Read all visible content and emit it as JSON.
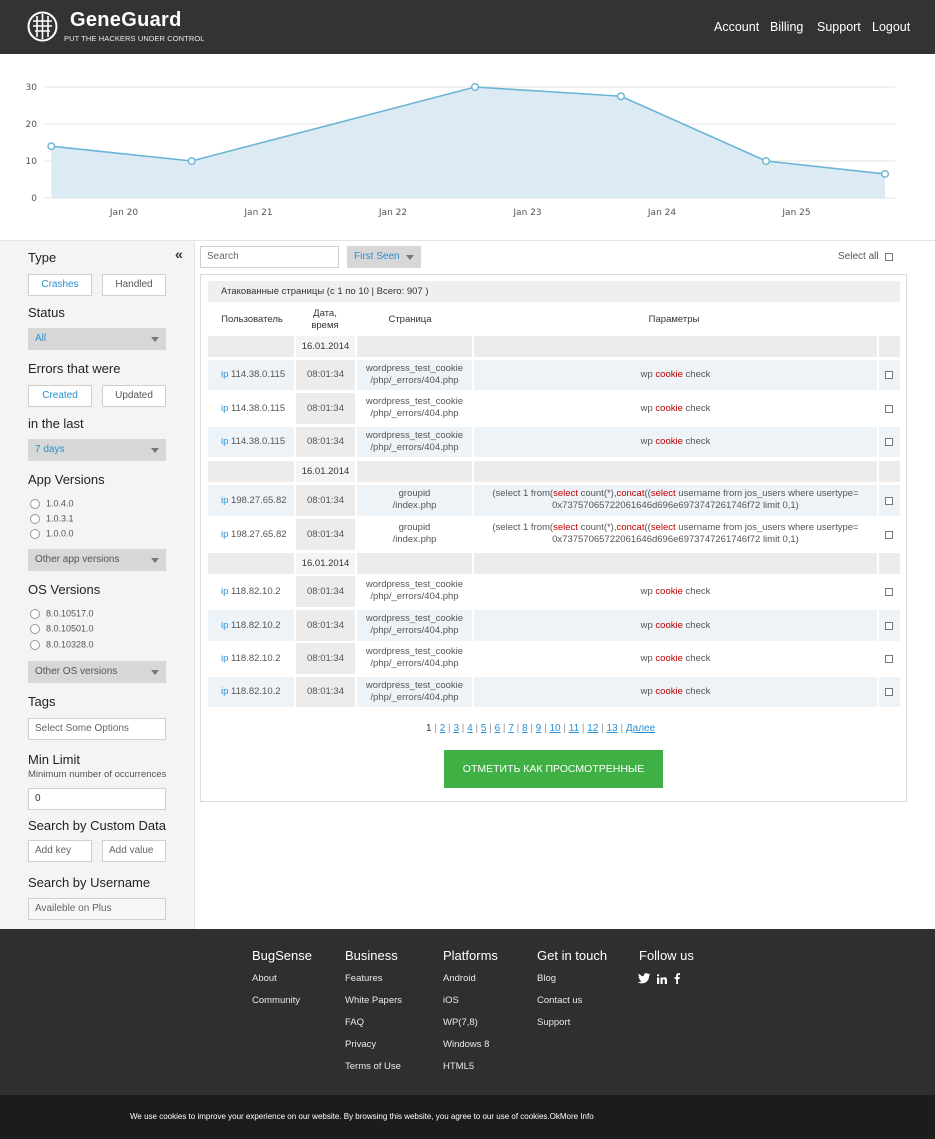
{
  "header": {
    "brand": "GeneGuard",
    "tagline": "PUT THE HACKERS UNDER CONTROL",
    "nav": [
      "Account",
      "Billing",
      "Support",
      "Logout"
    ]
  },
  "chart_data": {
    "type": "area",
    "x": [
      "Jan 19.8",
      "Jan 20.8",
      "Jan 21.8",
      "Jan 22.8",
      "Jan 23.8",
      "Jan 24.8",
      "Jan 25.7"
    ],
    "categories": [
      "Jan 20",
      "Jan 21",
      "Jan 22",
      "Jan 23",
      "Jan 24",
      "Jan 25"
    ],
    "values": [
      14,
      10,
      30,
      27.5,
      10,
      6.5
    ],
    "y_ticks": [
      "0",
      "10",
      "20",
      "30"
    ],
    "ylim": [
      0,
      32
    ],
    "grid": true,
    "colors": {
      "line": "#6bb4d6",
      "fill": "#dceaf3"
    }
  },
  "sidebar": {
    "type_label": "Type",
    "type_options": [
      "Crashes",
      "Handled"
    ],
    "status_label": "Status",
    "status_value": "All",
    "errors_label": "Errors that were",
    "errors_options": [
      "Created",
      "Updated"
    ],
    "last_label": "in the last",
    "last_value": "7 days",
    "app_versions_label": "App Versions",
    "app_versions": [
      "1.0.4.0",
      "1.0.3.1",
      "1.0.0.0"
    ],
    "other_app_versions": "Other app versions",
    "os_versions_label": "OS Versions",
    "os_versions": [
      "8.0.10517.0",
      "8.0.10501.0",
      "8.0.10328.0"
    ],
    "other_os_versions": "Other OS versions",
    "tags_label": "Tags",
    "tags_placeholder": "Select Some Options",
    "min_limit_label": "Min Limit",
    "min_limit_sub": "Minimum number of occurrences",
    "min_limit_value": "0",
    "custom_data_label": "Search by Custom Data",
    "add_key": "Add key",
    "add_value": "Add value",
    "username_label": "Search by Username",
    "username_placeholder": "Availeble on Plus"
  },
  "main": {
    "search_placeholder": "Search",
    "sort_value": "First Seen",
    "select_all": "Select all",
    "panel_title": "Атакованные страницы (с 1 по 10 | Всего: 907 )",
    "columns": [
      "Пользователь",
      "Дата, время",
      "Страница",
      "Параметры"
    ],
    "groups": [
      {
        "date": "16.01.2014",
        "rows": [
          {
            "ip": "114.38.0.115",
            "time": "08:01:34",
            "page": [
              "wordpress_test_cookie",
              "/php/_errors/404.php"
            ],
            "params": "wp"
          },
          {
            "ip": "114.38.0.115",
            "time": "08:01:34",
            "page": [
              "wordpress_test_cookie",
              "/php/_errors/404.php"
            ],
            "params": "wp"
          },
          {
            "ip": "114.38.0.115",
            "time": "08:01:34",
            "page": [
              "wordpress_test_cookie",
              "/php/_errors/404.php"
            ],
            "params": "wp"
          }
        ]
      },
      {
        "date": "16.01.2014",
        "rows": [
          {
            "ip": "198.27.65.82",
            "time": "08:01:34",
            "page": [
              "groupid",
              "/index.php"
            ],
            "params": "sql"
          },
          {
            "ip": "198.27.65.82",
            "time": "08:01:34",
            "page": [
              "groupid",
              "/index.php"
            ],
            "params": "sql"
          }
        ]
      },
      {
        "date": "16.01.2014",
        "rows": [
          {
            "ip": "118.82.10.2",
            "time": "08:01:34",
            "page": [
              "wordpress_test_cookie",
              "/php/_errors/404.php"
            ],
            "params": "wp"
          },
          {
            "ip": "118.82.10.2",
            "time": "08:01:34",
            "page": [
              "wordpress_test_cookie",
              "/php/_errors/404.php"
            ],
            "params": "wp"
          },
          {
            "ip": "118.82.10.2",
            "time": "08:01:34",
            "page": [
              "wordpress_test_cookie",
              "/php/_errors/404.php"
            ],
            "params": "wp"
          },
          {
            "ip": "118.82.10.2",
            "time": "08:01:34",
            "page": [
              "wordpress_test_cookie",
              "/php/_errors/404.php"
            ],
            "params": "wp"
          }
        ]
      }
    ],
    "ip_prefix": "ip",
    "wp_params": [
      "wp ",
      "cookie",
      " check"
    ],
    "sql_params": {
      "line1": [
        "(select 1 from(",
        "select",
        " count(*),",
        "concat",
        "((",
        "select",
        " username from jos_users where usertype="
      ],
      "line2": "0x73757065722061646d696e6973747261746f72 limit 0,1)"
    },
    "pagination": [
      "1",
      "2",
      "3",
      "4",
      "5",
      "6",
      "7",
      "8",
      "9",
      "10",
      "11",
      "12",
      "13",
      "Далее"
    ],
    "mark_button": "ОТМЕТИТЬ КАК ПРОСМОТРЕННЫЕ"
  },
  "footer": {
    "columns": [
      {
        "title": "BugSense",
        "links": [
          "About",
          "Community"
        ]
      },
      {
        "title": "Business",
        "links": [
          "Features",
          "White Papers",
          "FAQ",
          "Privacy",
          "Terms of Use"
        ]
      },
      {
        "title": "Platforms",
        "links": [
          "Android",
          "iOS",
          "WP(7,8)",
          "Windows 8",
          "HTML5"
        ]
      },
      {
        "title": "Get in touch",
        "links": [
          "Blog",
          "Contact us",
          "Support"
        ]
      },
      {
        "title": "Follow us",
        "links": []
      }
    ],
    "social_icons": [
      "twitter-icon",
      "linkedin-icon",
      "facebook-icon"
    ]
  },
  "cookie_bar": "We use cookies to improve your experience on our website. By browsing this website, you agree to our use of cookies.OkMore Info"
}
